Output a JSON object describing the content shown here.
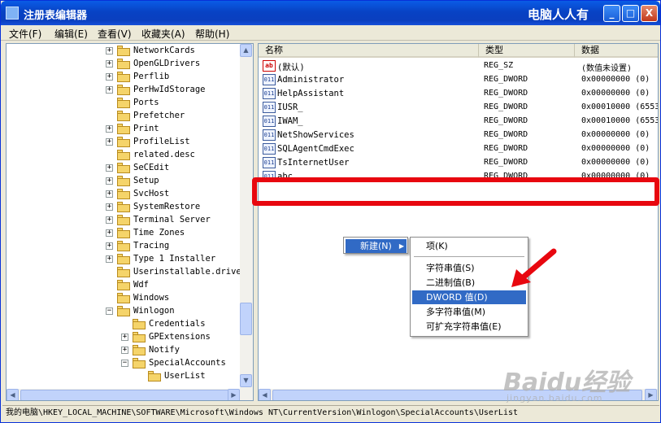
{
  "window": {
    "title": "注册表编辑器",
    "brand": "电脑人人有",
    "controls": {
      "minimize": "_",
      "maximize": "□",
      "close": "X"
    }
  },
  "menubar": [
    "文件(F)",
    "编辑(E)",
    "查看(V)",
    "收藏夹(A)",
    "帮助(H)"
  ],
  "tree": {
    "items": [
      {
        "label": "NetworkCards",
        "expandable": true,
        "indent": 0
      },
      {
        "label": "OpenGLDrivers",
        "expandable": true,
        "indent": 0
      },
      {
        "label": "Perflib",
        "expandable": true,
        "indent": 0
      },
      {
        "label": "PerHwIdStorage",
        "expandable": true,
        "indent": 0
      },
      {
        "label": "Ports",
        "expandable": false,
        "indent": 0
      },
      {
        "label": "Prefetcher",
        "expandable": false,
        "indent": 0
      },
      {
        "label": "Print",
        "expandable": true,
        "indent": 0
      },
      {
        "label": "ProfileList",
        "expandable": true,
        "indent": 0
      },
      {
        "label": "related.desc",
        "expandable": false,
        "indent": 0
      },
      {
        "label": "SeCEdit",
        "expandable": true,
        "indent": 0
      },
      {
        "label": "Setup",
        "expandable": true,
        "indent": 0
      },
      {
        "label": "SvcHost",
        "expandable": true,
        "indent": 0
      },
      {
        "label": "SystemRestore",
        "expandable": true,
        "indent": 0
      },
      {
        "label": "Terminal Server",
        "expandable": true,
        "indent": 0
      },
      {
        "label": "Time Zones",
        "expandable": true,
        "indent": 0
      },
      {
        "label": "Tracing",
        "expandable": true,
        "indent": 0
      },
      {
        "label": "Type 1 Installer",
        "expandable": true,
        "indent": 0
      },
      {
        "label": "Userinstallable.drivers",
        "expandable": false,
        "indent": 0
      },
      {
        "label": "Wdf",
        "expandable": false,
        "indent": 0
      },
      {
        "label": "Windows",
        "expandable": false,
        "indent": 0
      },
      {
        "label": "Winlogon",
        "expandable": true,
        "expanded": true,
        "indent": 0
      },
      {
        "label": "Credentials",
        "expandable": false,
        "indent": 1
      },
      {
        "label": "GPExtensions",
        "expandable": true,
        "indent": 1
      },
      {
        "label": "Notify",
        "expandable": true,
        "indent": 1
      },
      {
        "label": "SpecialAccounts",
        "expandable": true,
        "expanded": true,
        "indent": 1
      },
      {
        "label": "UserList",
        "expandable": false,
        "indent": 2,
        "open": true
      }
    ]
  },
  "values": {
    "columns": [
      "名称",
      "类型",
      "数据"
    ],
    "rows": [
      {
        "icon": "ab",
        "name": "(默认)",
        "type": "REG_SZ",
        "data": "(数值未设置)"
      },
      {
        "icon": "dword",
        "name": "Administrator",
        "type": "REG_DWORD",
        "data": "0x00000000 (0)"
      },
      {
        "icon": "dword",
        "name": "HelpAssistant",
        "type": "REG_DWORD",
        "data": "0x00000000 (0)"
      },
      {
        "icon": "dword",
        "name": "IUSR_",
        "type": "REG_DWORD",
        "data": "0x00010000 (6553"
      },
      {
        "icon": "dword",
        "name": "IWAM_",
        "type": "REG_DWORD",
        "data": "0x00010000 (6553"
      },
      {
        "icon": "dword",
        "name": "NetShowServices",
        "type": "REG_DWORD",
        "data": "0x00000000 (0)"
      },
      {
        "icon": "dword",
        "name": "SQLAgentCmdExec",
        "type": "REG_DWORD",
        "data": "0x00000000 (0)"
      },
      {
        "icon": "dword",
        "name": "TsInternetUser",
        "type": "REG_DWORD",
        "data": "0x00000000 (0)"
      },
      {
        "icon": "dword",
        "name": "abc",
        "type": "REG_DWORD",
        "data": "0x00000000 (0)"
      }
    ],
    "icon_labels": {
      "ab": "ab",
      "dword": "011"
    }
  },
  "context_menu": {
    "parent": "新建(N)",
    "submenu": [
      "项(K)",
      "字符串值(S)",
      "二进制值(B)",
      "DWORD 值(D)",
      "多字符串值(M)",
      "可扩充字符串值(E)"
    ],
    "selected": "DWORD 值(D)"
  },
  "statusbar": "我的电脑\\HKEY_LOCAL_MACHINE\\SOFTWARE\\Microsoft\\Windows NT\\CurrentVersion\\Winlogon\\SpecialAccounts\\UserList",
  "watermark": {
    "main": "Baidu经验",
    "sub": "jingyan.baidu.com"
  },
  "colors": {
    "highlight": "#e8070f",
    "selection": "#316ac5",
    "titlebar": "#0a5ce6"
  }
}
